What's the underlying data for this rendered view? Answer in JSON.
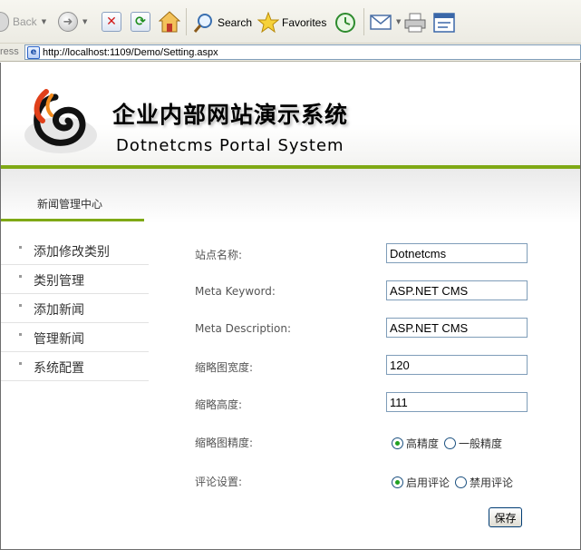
{
  "toolbar": {
    "back_label": "Back",
    "search_label": "Search",
    "favorites_label": "Favorites"
  },
  "address": {
    "label": "ress",
    "url": "http://localhost:1109/Demo/Setting.aspx"
  },
  "header": {
    "title": "企业内部网站演示系统",
    "subtitle": "Dotnetcms Portal System",
    "accent_color": "#7fa915"
  },
  "nav": {
    "active_tab": "新闻管理中心"
  },
  "sidebar": {
    "items": [
      {
        "label": "添加修改类别"
      },
      {
        "label": "类别管理"
      },
      {
        "label": "添加新闻"
      },
      {
        "label": "管理新闻"
      },
      {
        "label": "系统配置"
      }
    ]
  },
  "form": {
    "site_name": {
      "label": "站点名称:",
      "value": "Dotnetcms"
    },
    "meta_keyword": {
      "label": "Meta Keyword:",
      "value": "ASP.NET CMS"
    },
    "meta_description": {
      "label": "Meta Description:",
      "value": "ASP.NET CMS"
    },
    "thumb_width": {
      "label": "缩略图宽度:",
      "value": "120"
    },
    "thumb_height": {
      "label": "缩略高度:",
      "value": "111"
    },
    "thumb_precision": {
      "label": "缩略图精度:",
      "options": [
        "高精度",
        "一般精度"
      ],
      "selected": "高精度"
    },
    "comments": {
      "label": "评论设置:",
      "options": [
        "启用评论",
        "禁用评论"
      ],
      "selected": "启用评论"
    },
    "save_label": "保存"
  }
}
